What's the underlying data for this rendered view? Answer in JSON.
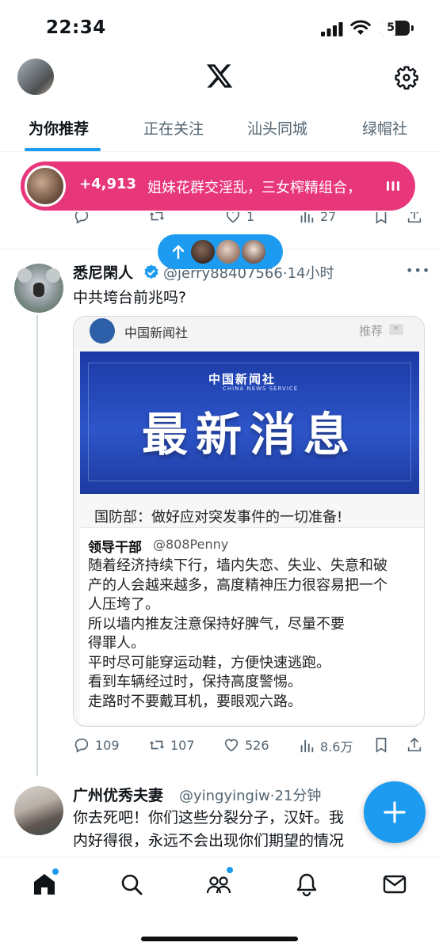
{
  "status_bar": {
    "time": "22:34",
    "battery": "52",
    "battery_level_fraction": 0.52
  },
  "header": {
    "logo": "x-logo-icon",
    "settings_icon": "gear-icon"
  },
  "tabs": [
    {
      "label": "为你推荐",
      "active": true
    },
    {
      "label": "正在关注",
      "active": false
    },
    {
      "label": "汕头同城",
      "active": false
    },
    {
      "label": "绿帽社",
      "active": false
    }
  ],
  "live_banner": {
    "count": "+4,913",
    "text": "姐妹花群交淫乱，三女榨精组合，",
    "color": "#e8367a"
  },
  "previous_post_actions": {
    "likes": "1",
    "views": "27"
  },
  "new_posts_pill": {
    "icon": "arrow-up-icon"
  },
  "post": {
    "author": "悉尼閑人",
    "handle": "@jerry88407566",
    "time": "14小时",
    "text": "中共垮台前兆吗?",
    "media": {
      "source_name": "中国新闻社",
      "recommend_label": "推荐",
      "banner_logo": "中国新闻社",
      "banner_logo_sub": "CHINA NEWS SERVICE",
      "banner_title": "最新消息",
      "headline": "国防部：做好应对突发事件的一切准备!",
      "quote": {
        "author": "领导干部",
        "handle": "@808Penny",
        "lines": [
          "随着经济持续下行，墙内失恋、失业、失意和破",
          "产的人会越来越多，高度精神压力很容易把一个",
          "人压垮了。",
          "所以墙内推友注意保持好脾气，尽量不要",
          "得罪人。",
          "平时尽可能穿运动鞋，方便快速逃跑。",
          "看到车辆经过时，保持高度警惕。",
          "走路时不要戴耳机，要眼观六路。"
        ]
      }
    },
    "actions": {
      "replies": "109",
      "reposts": "107",
      "likes": "526",
      "views": "8.6万"
    }
  },
  "post2": {
    "author": "广州优秀夫妻",
    "handle": "@yingyingiw",
    "time": "21分钟",
    "lines": [
      "你去死吧！你们这些分裂分子，汉奸。我",
      "内好得很，永远不会出现你们期望的情况"
    ]
  },
  "fab": {
    "icon": "plus-icon"
  },
  "bottom_nav": [
    {
      "name": "home-icon",
      "active": true
    },
    {
      "name": "search-icon",
      "active": false
    },
    {
      "name": "communities-icon",
      "active": false
    },
    {
      "name": "notifications-icon",
      "active": false
    },
    {
      "name": "messages-icon",
      "active": false
    }
  ],
  "colors": {
    "accent": "#1d9bf0",
    "text": "#0f1419",
    "muted": "#536471"
  }
}
